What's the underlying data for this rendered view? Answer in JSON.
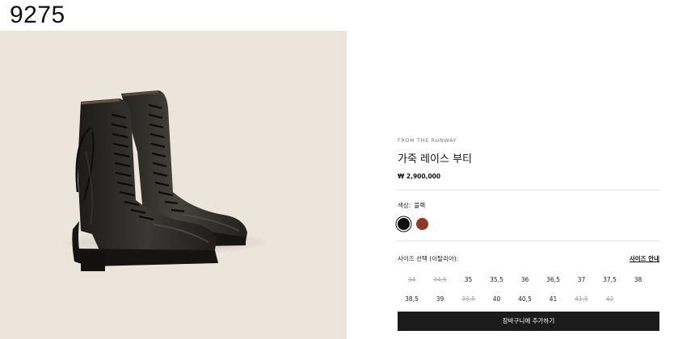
{
  "page_id": "9275",
  "product": {
    "eyebrow": "FROM THE RUNWAY",
    "name": "가죽 레이스 부티",
    "price": "₩ 2,900,000",
    "image_icon": "leather-lace-up-boots"
  },
  "color": {
    "label": "색상:",
    "selected": "블랙",
    "swatches": [
      {
        "name": "black",
        "hex": "#111111",
        "selected": true
      },
      {
        "name": "brown",
        "hex": "#8e3a24",
        "selected": false
      }
    ]
  },
  "size": {
    "label": "사이즈 선택 (이탈리아):",
    "guide": "사이즈 안내",
    "options": [
      {
        "label": "34",
        "available": false
      },
      {
        "label": "34,5",
        "available": false
      },
      {
        "label": "35",
        "available": true
      },
      {
        "label": "35,5",
        "available": true
      },
      {
        "label": "36",
        "available": true
      },
      {
        "label": "36,5",
        "available": true
      },
      {
        "label": "37",
        "available": true
      },
      {
        "label": "37,5",
        "available": true
      },
      {
        "label": "38",
        "available": true
      },
      {
        "label": "38,5",
        "available": true
      },
      {
        "label": "39",
        "available": true
      },
      {
        "label": "39,5",
        "available": false
      },
      {
        "label": "40",
        "available": true
      },
      {
        "label": "40,5",
        "available": true
      },
      {
        "label": "41",
        "available": true
      },
      {
        "label": "41,5",
        "available": false
      },
      {
        "label": "42",
        "available": false
      }
    ]
  },
  "cart": {
    "label": "장바구니에 추가하기"
  }
}
